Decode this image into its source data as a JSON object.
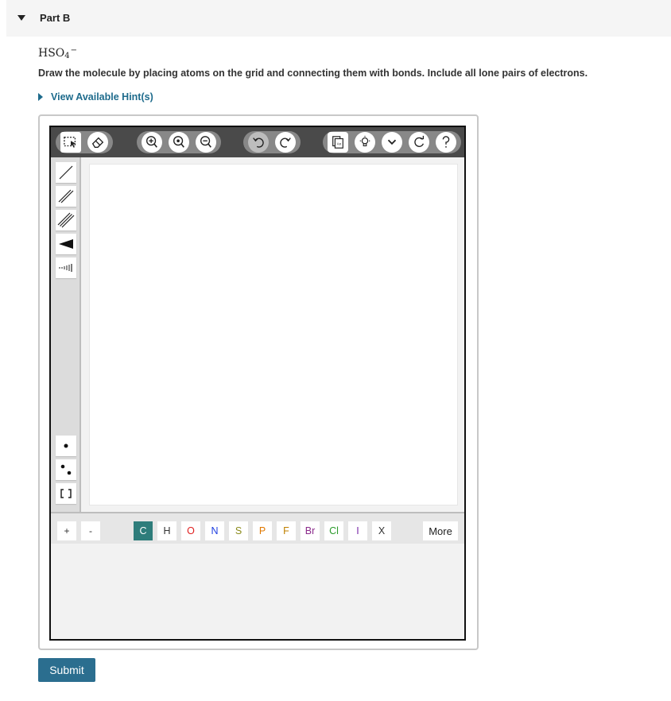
{
  "part": {
    "title": "Part B"
  },
  "question": {
    "formula_base": "HSO",
    "formula_subscript": "4",
    "formula_charge": "−",
    "instructions": "Draw the molecule by placing atoms on the grid and connecting them with bonds. Include all lone pairs of electrons."
  },
  "hint": {
    "label": "View Available Hint(s)"
  },
  "toolbar": {
    "icons": [
      "select-icon",
      "eraser-icon",
      "zoom-in-icon",
      "zoom-fit-icon",
      "zoom-out-icon",
      "undo-icon",
      "redo-icon",
      "template-icon",
      "lightbulb-icon",
      "chevron-down-icon",
      "refresh-icon",
      "help-icon"
    ]
  },
  "side_tools": [
    "single-bond",
    "double-bond",
    "triple-bond",
    "wedge-bond",
    "hash-bond",
    "radical",
    "lone-pair",
    "brackets"
  ],
  "charges": {
    "plus": "+",
    "minus": "-"
  },
  "atoms": [
    {
      "symbol": "C",
      "color": "#ffffff",
      "active": true
    },
    {
      "symbol": "H",
      "color": "#333333"
    },
    {
      "symbol": "O",
      "color": "#e02020"
    },
    {
      "symbol": "N",
      "color": "#2040e0"
    },
    {
      "symbol": "S",
      "color": "#8a8a1a"
    },
    {
      "symbol": "P",
      "color": "#e07800"
    },
    {
      "symbol": "F",
      "color": "#c08000"
    },
    {
      "symbol": "Br",
      "color": "#8a2a8a"
    },
    {
      "symbol": "Cl",
      "color": "#2a9a2a"
    },
    {
      "symbol": "I",
      "color": "#7a2aaa"
    },
    {
      "symbol": "X",
      "color": "#333333"
    }
  ],
  "more_label": "More",
  "submit_label": "Submit",
  "colors": {
    "accent": "#2b6e8f",
    "toolbar": "#4a4a4a",
    "carbon_active": "#2e7d7b"
  }
}
